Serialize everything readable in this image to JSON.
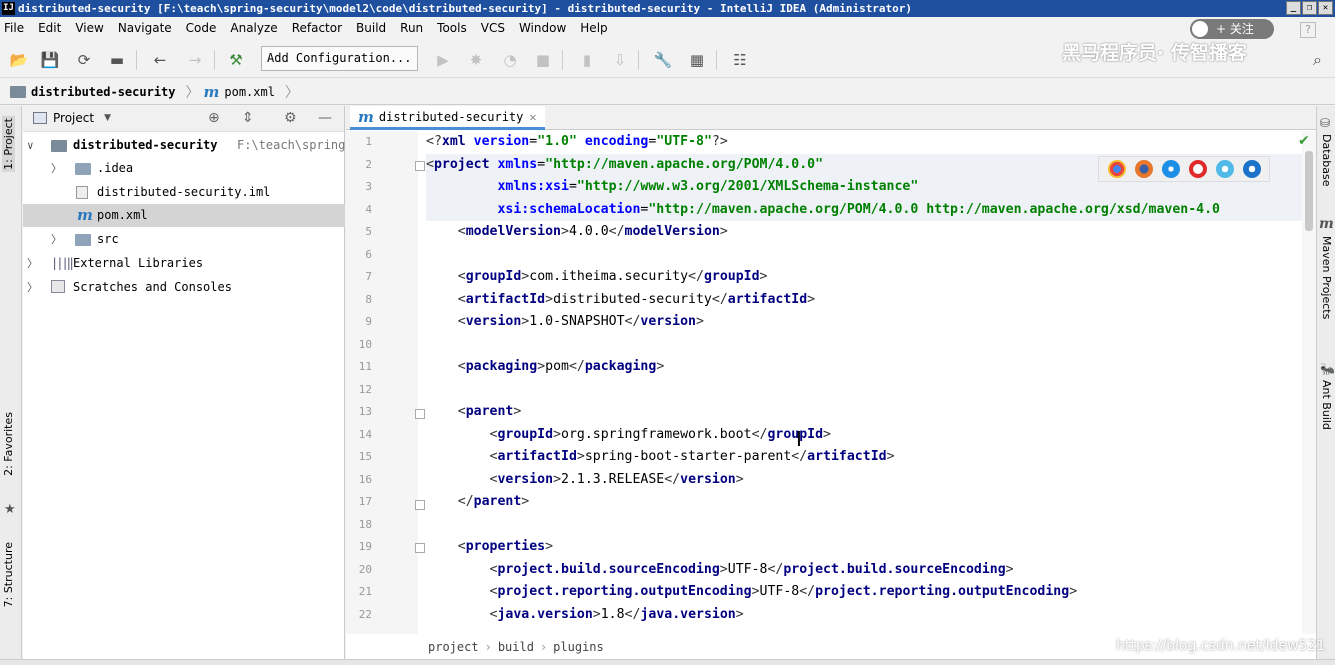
{
  "window": {
    "title": "distributed-security [F:\\teach\\spring-security\\model2\\code\\distributed-security] - distributed-security - IntelliJ IDEA (Administrator)",
    "icon": "IJ"
  },
  "menu": [
    "File",
    "Edit",
    "View",
    "Navigate",
    "Code",
    "Analyze",
    "Refactor",
    "Build",
    "Run",
    "Tools",
    "VCS",
    "Window",
    "Help"
  ],
  "overlay": {
    "follow_label": "+ 关注",
    "watermark": "黑马程序员· 传智播客",
    "csdn": "https://blog.csdn.net/ldew521"
  },
  "toolbar": {
    "add_configuration": "Add Configuration..."
  },
  "navbar": {
    "project": "distributed-security",
    "file": "pom.xml"
  },
  "tool_windows": {
    "project": "1: Project",
    "favorites": "2: Favorites",
    "structure": "7: Structure",
    "database": "Database",
    "maven": "Maven Projects",
    "ant": "Ant Build"
  },
  "project_panel": {
    "selector": "Project",
    "tree": [
      {
        "label": "distributed-security",
        "hint": "F:\\teach\\spring",
        "icon": "module-folder-icon"
      },
      {
        "label": ".idea",
        "icon": "folder-icon"
      },
      {
        "label": "distributed-security.iml",
        "icon": "iml-file-icon"
      },
      {
        "label": "pom.xml",
        "icon": "maven-file-icon"
      },
      {
        "label": "src",
        "icon": "folder-icon"
      },
      {
        "label": "External Libraries",
        "icon": "libraries-icon"
      },
      {
        "label": "Scratches and Consoles",
        "icon": "scratches-icon"
      }
    ]
  },
  "editor": {
    "tab": "distributed-security",
    "line_numbers": [
      "1",
      "2",
      "3",
      "4",
      "5",
      "6",
      "7",
      "8",
      "9",
      "10",
      "11",
      "12",
      "13",
      "14",
      "15",
      "16",
      "17",
      "18",
      "19",
      "20",
      "21",
      "22"
    ],
    "breadcrumb": [
      "project",
      "build",
      "plugins"
    ]
  }
}
